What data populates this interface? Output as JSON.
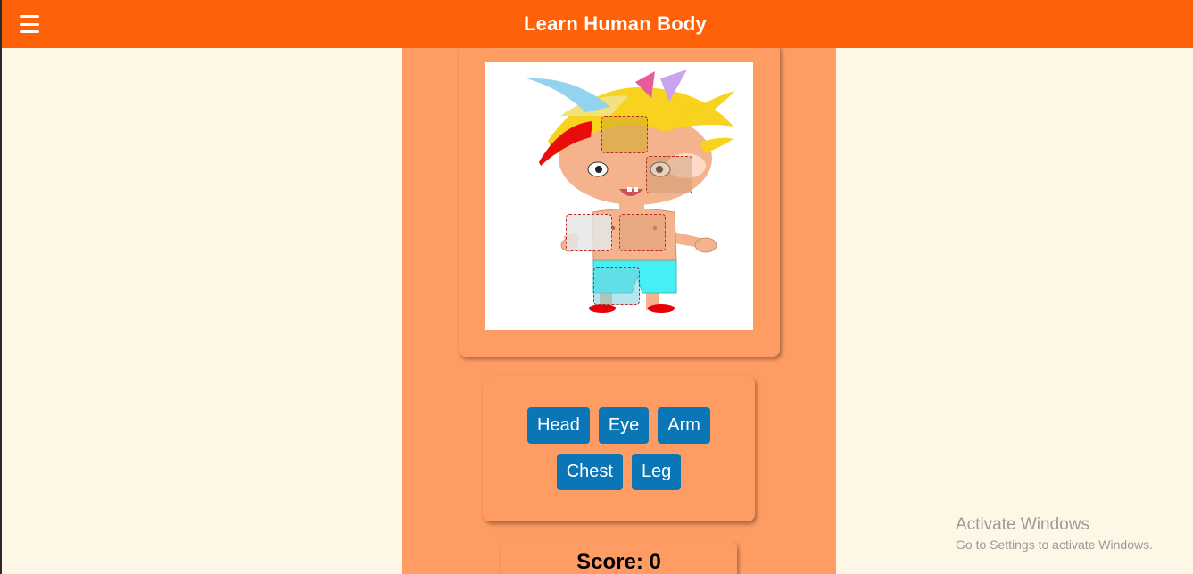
{
  "app": {
    "title": "Learn Human Body"
  },
  "colors": {
    "header": "#ff6108",
    "panel": "#ff9c63",
    "button": "#0b76b5",
    "page_bg": "#fff7e6"
  },
  "icons": {
    "menu": "hamburger-menu-icon"
  },
  "image": {
    "subject": "cartoon boy character"
  },
  "hotspots": [
    "head",
    "eye",
    "arm",
    "chest",
    "leg"
  ],
  "labels": {
    "row1": [
      "Head",
      "Eye",
      "Arm"
    ],
    "row2": [
      "Chest",
      "Leg"
    ]
  },
  "score": {
    "text": "Score: 0"
  },
  "watermark": {
    "line1": "Activate Windows",
    "line2": "Go to Settings to activate Windows."
  }
}
